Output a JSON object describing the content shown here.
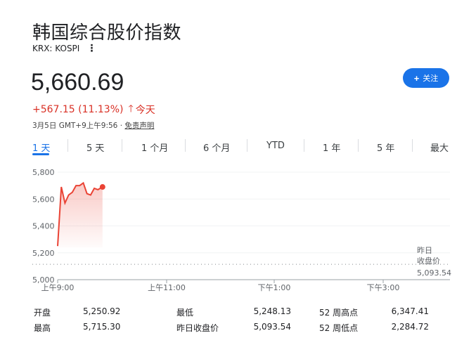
{
  "header": {
    "title": "韩国综合股价指数",
    "exchange": "KRX: KOSPI",
    "more_icon": "⋮"
  },
  "quote": {
    "price": "5,660.69",
    "change": "+567.15 (11.13%)",
    "change_arrow": "🡑",
    "change_period": "今天",
    "timestamp": "3月5日 GMT+9上午9:56 · ",
    "disclaimer": "免责声明"
  },
  "follow_button": {
    "label": "关注",
    "icon": "plus-icon"
  },
  "tabs": [
    "1 天",
    "5 天",
    "1 个月",
    "6 个月",
    "YTD",
    "1 年",
    "5 年",
    "最大"
  ],
  "colors": {
    "accent": "#1a73e8",
    "up": "#d93025",
    "line": "#ea4335"
  },
  "chart_data": {
    "type": "line",
    "y_ticks": [
      "5,800",
      "5,600",
      "5,400",
      "5,200",
      "5,000"
    ],
    "ylim": [
      5000,
      5800
    ],
    "x_ticks": [
      "上午9:00",
      "上午11:00",
      "下午1:00",
      "下午3:00"
    ],
    "prev_close": 5093.54,
    "prev_close_label": [
      "昨日",
      "收盘价"
    ],
    "prev_close_value": "5,093.54",
    "series": [
      {
        "values": [
          [
            0,
            5250
          ],
          [
            4,
            5690
          ],
          [
            8,
            5570
          ],
          [
            12,
            5630
          ],
          [
            16,
            5650
          ],
          [
            20,
            5700
          ],
          [
            24,
            5700
          ],
          [
            28,
            5720
          ],
          [
            32,
            5640
          ],
          [
            36,
            5630
          ],
          [
            40,
            5680
          ],
          [
            44,
            5670
          ],
          [
            49,
            5690
          ]
        ]
      }
    ],
    "x_range_minutes": [
      0,
      390
    ]
  },
  "stats": {
    "open_label": "开盘",
    "open_value": "5,250.92",
    "high_label": "最高",
    "high_value": "5,715.30",
    "low_label": "最低",
    "low_value": "5,248.13",
    "prev_close_label": "昨日收盘价",
    "prev_close_value": "5,093.54",
    "wk52_high_label": "52 周高点",
    "wk52_high_value": "6,347.41",
    "wk52_low_label": "52 周低点",
    "wk52_low_value": "2,284.72"
  }
}
